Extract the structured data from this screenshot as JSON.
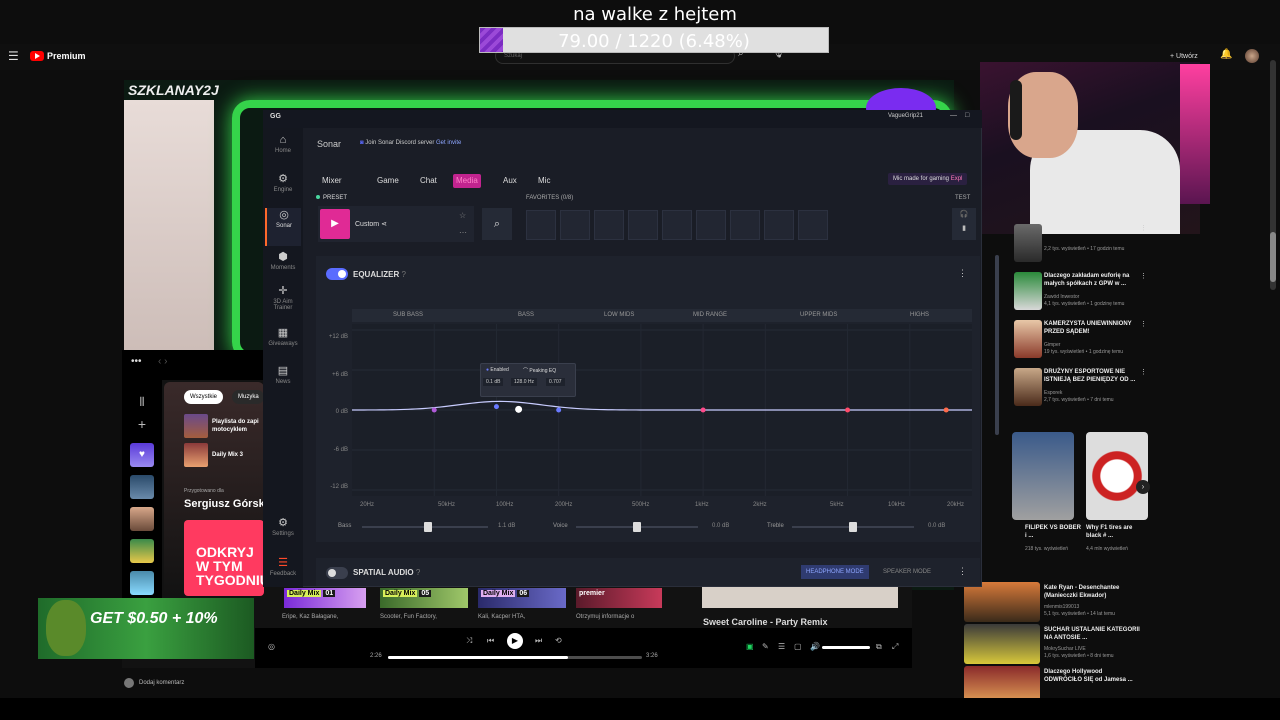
{
  "overlay": {
    "title": "na walke z hejtem",
    "goal_text": "79.00 / 1220 (6.48%)",
    "goal_fraction": 0.0648
  },
  "youtube": {
    "logo": "Premium",
    "search_placeholder": "Szukaj",
    "create": "+ Utwórz",
    "side_videos": [
      {
        "title": "",
        "meta": "2,2 tys. wyświetleń • 17 godzin temu",
        "badge": "Nowy"
      },
      {
        "title": "Dlaczego zakładam euforię na małych spółkach z GPW w ...",
        "meta": "Zawód Inwestor\n4,1 tys. wyświetleń • 1 godzinę temu",
        "badge": "Nowy"
      },
      {
        "title": "KAMERZYSTA UNIEWINNIONY PRZED SĄDEM!",
        "meta": "Gimper\n19 tys. wyświetleń • 1 godzinę temu",
        "badge": "Nowy"
      },
      {
        "title": "DRUŻYNY ESPORTOWE NIE ISTNIEJĄ BEZ PIENIĘDZY OD ...",
        "meta": "Esporek\n2,7 tys. wyświetleń • 7 dni temu",
        "badge": ""
      }
    ],
    "shorts": [
      {
        "title": "FILIPEK VS BOBER i ...",
        "meta": "218 tys. wyświetleń"
      },
      {
        "title": "Why F1 tires are black # ...",
        "meta": "4,4 mln wyświetleń"
      }
    ],
    "side_videos2": [
      {
        "title": "Kate Ryan - Desenchantee (Maniecczki Ekwador)",
        "meta": "mlenmis199013\n5,1 tys. wyświetleń • 14 lat temu"
      },
      {
        "title": "SUCHAR USTALANIE KATEGORII NA ANTOSIE ...",
        "meta": "MokrySuchar LIVE\n1,6 tys. wyświetleń • 8 dni temu"
      },
      {
        "title": "Dlaczego Hollywood ODWRÓCIŁO SIĘ od Jamesa ...",
        "meta": ""
      }
    ],
    "comment": "Dodaj komentarz"
  },
  "stream": {
    "logo": "SZKLANAY2J"
  },
  "spotify": {
    "chips": [
      "Wszystkie",
      "Muzyka"
    ],
    "list": [
      {
        "title": "Playlista do zapi motocyklem"
      },
      {
        "title": "Daily Mix 3"
      }
    ],
    "prepared_for": "Przygotowano dla",
    "user_name": "Sergiusz Górski",
    "card_text": "ODKRYJ W TYM TYGODNIU",
    "mixes": [
      {
        "label": "Daily Mix",
        "num": "01",
        "artists": "Eripe, Kaz Bałagane,"
      },
      {
        "label": "Daily Mix",
        "num": "05",
        "artists": "Scooter, Fun Factory,"
      },
      {
        "label": "Daily Mix",
        "num": "06",
        "artists": "Kali, Kacper HTA,"
      }
    ],
    "premier": "premier",
    "premier_label": "Otrzymuj informacje o",
    "banner_title": "Sweet Caroline - Party Remix",
    "time_elapsed": "2:26",
    "time_total": "3:26",
    "progress_fraction": 0.71
  },
  "ad": {
    "text": "GET $0.50 + 10%"
  },
  "gg": {
    "logo": "GG",
    "user": "VagueGrip21",
    "nav": [
      {
        "label": "Home",
        "icon": "home-icon",
        "glyph": "⌂"
      },
      {
        "label": "Engine",
        "icon": "engine-icon",
        "glyph": "⚙"
      },
      {
        "label": "Sonar",
        "icon": "sonar-icon",
        "glyph": "◎"
      },
      {
        "label": "Moments",
        "icon": "moments-icon",
        "glyph": "⬢"
      },
      {
        "label": "3D Aim Trainer",
        "icon": "aim-icon",
        "glyph": "✛"
      },
      {
        "label": "Giveaways",
        "icon": "giveaways-icon",
        "glyph": "▦"
      },
      {
        "label": "News",
        "icon": "news-icon",
        "glyph": "▤"
      },
      {
        "label": "Settings",
        "icon": "settings-icon",
        "glyph": "⚙"
      },
      {
        "label": "Feedback",
        "icon": "feedback-icon",
        "glyph": "☰"
      }
    ],
    "sonar_title": "Sonar",
    "discord_text": "Join Sonar Discord server",
    "discord_invite": "Get invite",
    "tabs": [
      "Mixer",
      "Game",
      "Chat",
      "Media",
      "Aux",
      "Mic"
    ],
    "active_tab": "Media",
    "mic_mode": "Mic made for gaming",
    "mic_mode_link": "Expl",
    "preset_label": "PRESET",
    "preset_name": "Custom",
    "favorites_label": "FAVORITES (0/8)",
    "test_label": "TEST",
    "equalizer_title": "EQUALIZER",
    "bands": [
      "SUB BASS",
      "BASS",
      "LOW MIDS",
      "MID RANGE",
      "UPPER MIDS",
      "HIGHS"
    ],
    "db_labels": [
      "+12 dB",
      "+6 dB",
      "0 dB",
      "-6 dB",
      "-12 dB"
    ],
    "hz_labels": [
      "20Hz",
      "50kHz",
      "100Hz",
      "200Hz",
      "500Hz",
      "1kHz",
      "2kHz",
      "5kHz",
      "10kHz",
      "20kHz"
    ],
    "tooltip": {
      "enabled": "Enabled",
      "type": "Peaking EQ",
      "gain": "0.1 dB",
      "freq": "128.0 Hz",
      "q": "0.707"
    },
    "sliders": [
      {
        "label": "Bass",
        "value": "1.1 dB",
        "level": 0.52
      },
      {
        "label": "Voice",
        "value": "0.0 dB",
        "level": 0.5
      },
      {
        "label": "Treble",
        "value": "0.0 dB",
        "level": 0.5
      }
    ],
    "spatial_title": "SPATIAL AUDIO",
    "headphone_mode": "HEADPHONE MODE",
    "speaker_mode": "SPEAKER MODE",
    "eq_points": [
      {
        "freq": 50,
        "gain": 0,
        "color": "#b05ad8"
      },
      {
        "freq": 100,
        "gain": 0.5,
        "color": "#6a7aff"
      },
      {
        "freq": 128,
        "gain": 0.1,
        "color": "#ffffff"
      },
      {
        "freq": 200,
        "gain": 0,
        "color": "#6a7aff"
      },
      {
        "freq": 1000,
        "gain": 0,
        "color": "#ff4a8a"
      },
      {
        "freq": 5000,
        "gain": 0,
        "color": "#ff4a6a"
      },
      {
        "freq": 15000,
        "gain": 0,
        "color": "#ff6a4a"
      }
    ]
  }
}
